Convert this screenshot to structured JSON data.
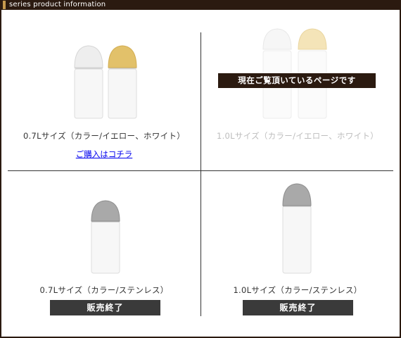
{
  "header": {
    "title": "series product information"
  },
  "products": [
    {
      "caption": "0.7Lサイズ（カラー/イエロー、ホワイト）",
      "link_label": "ご購入はコチラ"
    },
    {
      "caption": "1.0Lサイズ（カラー/イエロー、ホワイト）",
      "badge": "現在ご覧頂いているページです"
    },
    {
      "caption": "0.7Lサイズ（カラー/ステンレス）",
      "status": "販売終了"
    },
    {
      "caption": "1.0Lサイズ（カラー/ステンレス）",
      "status": "販売終了"
    }
  ],
  "colors": {
    "header_bg": "#2b1a10",
    "accent": "#c69a4e",
    "soldout_bg": "#3a3a3a",
    "link": "#0000ee",
    "yellow_cap": "#e2c16a",
    "white_cap": "#eeeeee",
    "steel_cap": "#a9a9a9"
  }
}
